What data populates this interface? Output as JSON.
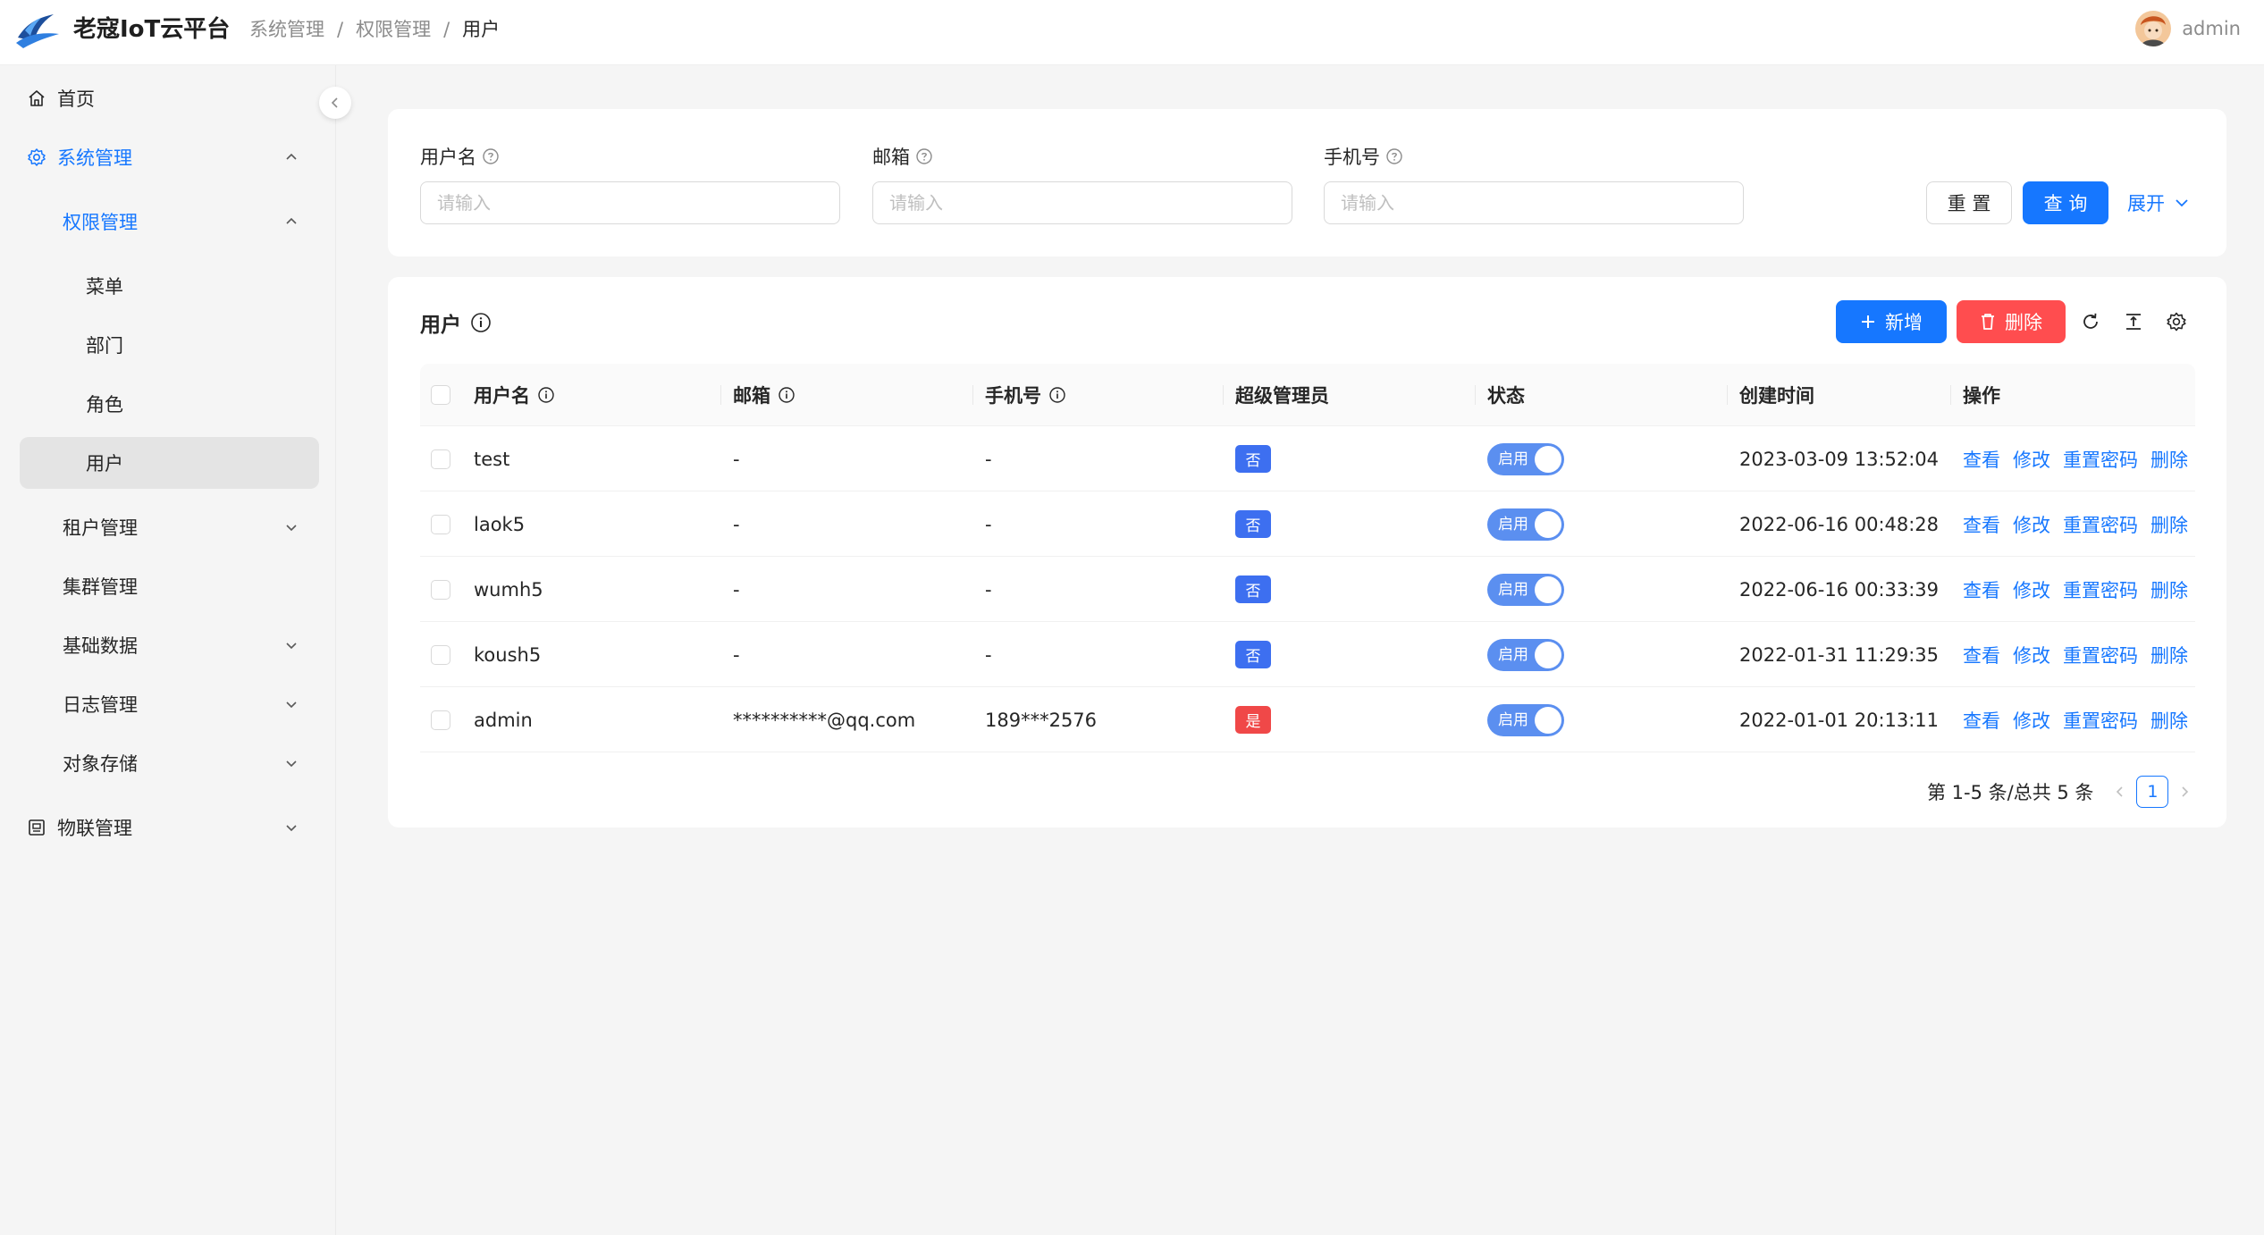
{
  "header": {
    "app_title": "老寇IoT云平台",
    "breadcrumb": [
      "系统管理",
      "权限管理",
      "用户"
    ],
    "breadcrumb_sep": "/",
    "username": "admin"
  },
  "sidebar": {
    "items": [
      {
        "label": "首页",
        "icon": "home-icon"
      },
      {
        "label": "系统管理",
        "icon": "gear-icon",
        "expanded": true
      },
      {
        "label": "权限管理",
        "expanded": true
      },
      {
        "label": "菜单"
      },
      {
        "label": "部门"
      },
      {
        "label": "角色"
      },
      {
        "label": "用户",
        "selected": true
      },
      {
        "label": "租户管理",
        "expandable": true
      },
      {
        "label": "集群管理"
      },
      {
        "label": "基础数据",
        "expandable": true
      },
      {
        "label": "日志管理",
        "expandable": true
      },
      {
        "label": "对象存储",
        "expandable": true
      },
      {
        "label": "物联管理",
        "icon": "robot-icon",
        "expandable": true
      }
    ]
  },
  "search": {
    "fields": [
      {
        "label": "用户名",
        "placeholder": "请输入",
        "value": ""
      },
      {
        "label": "邮箱",
        "placeholder": "请输入",
        "value": ""
      },
      {
        "label": "手机号",
        "placeholder": "请输入",
        "value": ""
      }
    ],
    "reset_label": "重 置",
    "query_label": "查 询",
    "expand_label": "展开"
  },
  "table": {
    "title": "用户",
    "add_label": "新增",
    "delete_label": "删除",
    "columns": [
      "用户名",
      "邮箱",
      "手机号",
      "超级管理员",
      "状态",
      "创建时间",
      "操作"
    ],
    "rows": [
      {
        "username": "test",
        "email": "-",
        "phone": "-",
        "admin": "否",
        "status": "启用",
        "created": "2023-03-09 13:52:04"
      },
      {
        "username": "laok5",
        "email": "-",
        "phone": "-",
        "admin": "否",
        "status": "启用",
        "created": "2022-06-16 00:48:28"
      },
      {
        "username": "wumh5",
        "email": "-",
        "phone": "-",
        "admin": "否",
        "status": "启用",
        "created": "2022-06-16 00:33:39"
      },
      {
        "username": "koush5",
        "email": "-",
        "phone": "-",
        "admin": "否",
        "status": "启用",
        "created": "2022-01-31 11:29:35"
      },
      {
        "username": "admin",
        "email": "**********@qq.com",
        "phone": "189***2576",
        "admin": "是",
        "status": "启用",
        "created": "2022-01-01 20:13:11"
      }
    ],
    "actions": [
      "查看",
      "修改",
      "重置密码",
      "删除"
    ],
    "pagination": {
      "summary": "第 1-5 条/总共 5 条",
      "current_page": "1"
    }
  },
  "colors": {
    "primary": "#1677ff",
    "danger": "#ff4d4f",
    "badge_no": "#3d6ff0",
    "badge_yes": "#f04848",
    "switch_on": "#5b8ff0"
  }
}
